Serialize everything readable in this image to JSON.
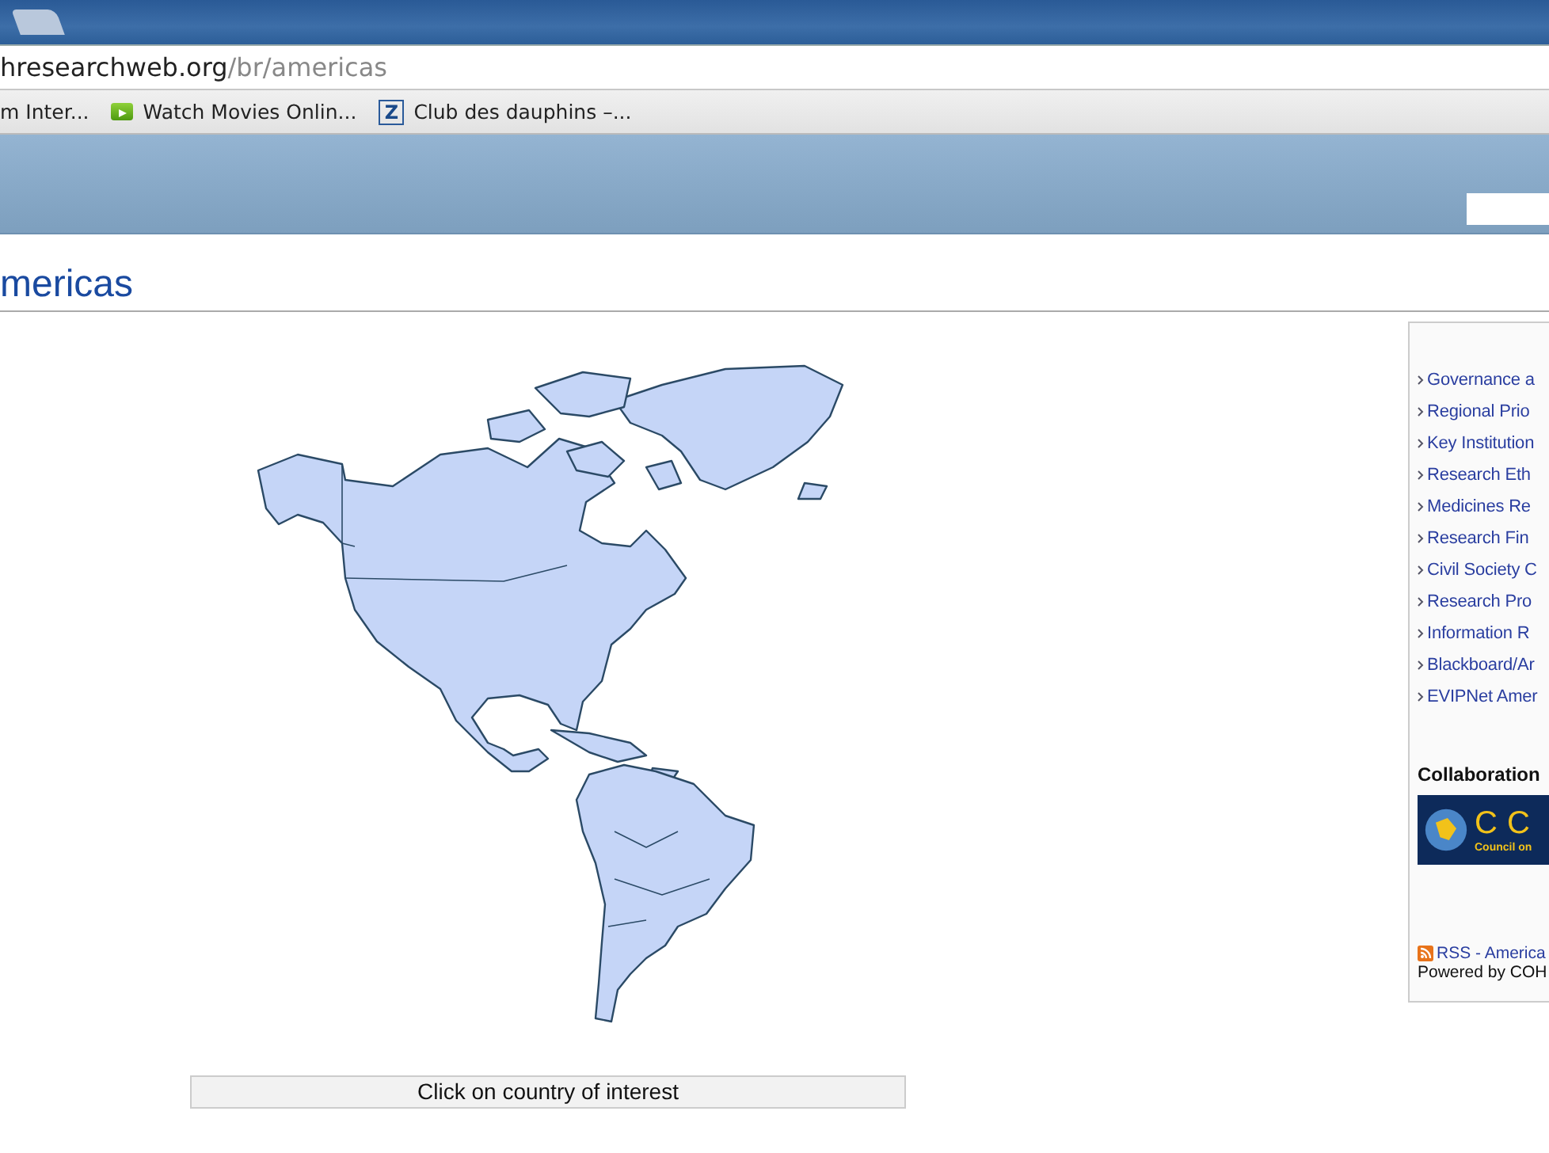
{
  "browser": {
    "address": {
      "host": "hresearchweb.org",
      "path": "/br/americas"
    },
    "bookmarks": [
      {
        "kind": "plain",
        "label": "m Inter..."
      },
      {
        "kind": "play",
        "label": "Watch Movies Onlin..."
      },
      {
        "kind": "letter",
        "icon_letter": "Z",
        "label": "Club des dauphins –..."
      }
    ]
  },
  "page": {
    "title": "mericas",
    "map_caption": "Click on country of interest",
    "sidebar": {
      "links": [
        "Governance a",
        "Regional Prio",
        "Key Institution",
        "Research Eth",
        "Medicines Re",
        "Research Fin",
        "Civil Society C",
        "Research Pro",
        "Information R",
        "Blackboard/Ar",
        "EVIPNet Amer"
      ],
      "collaboration_heading": "Collaboration",
      "logo": {
        "letters": [
          "C",
          "C"
        ],
        "tagline": "Council on"
      },
      "rss_link": "RSS - America",
      "powered_by": "Powered by COH"
    }
  }
}
